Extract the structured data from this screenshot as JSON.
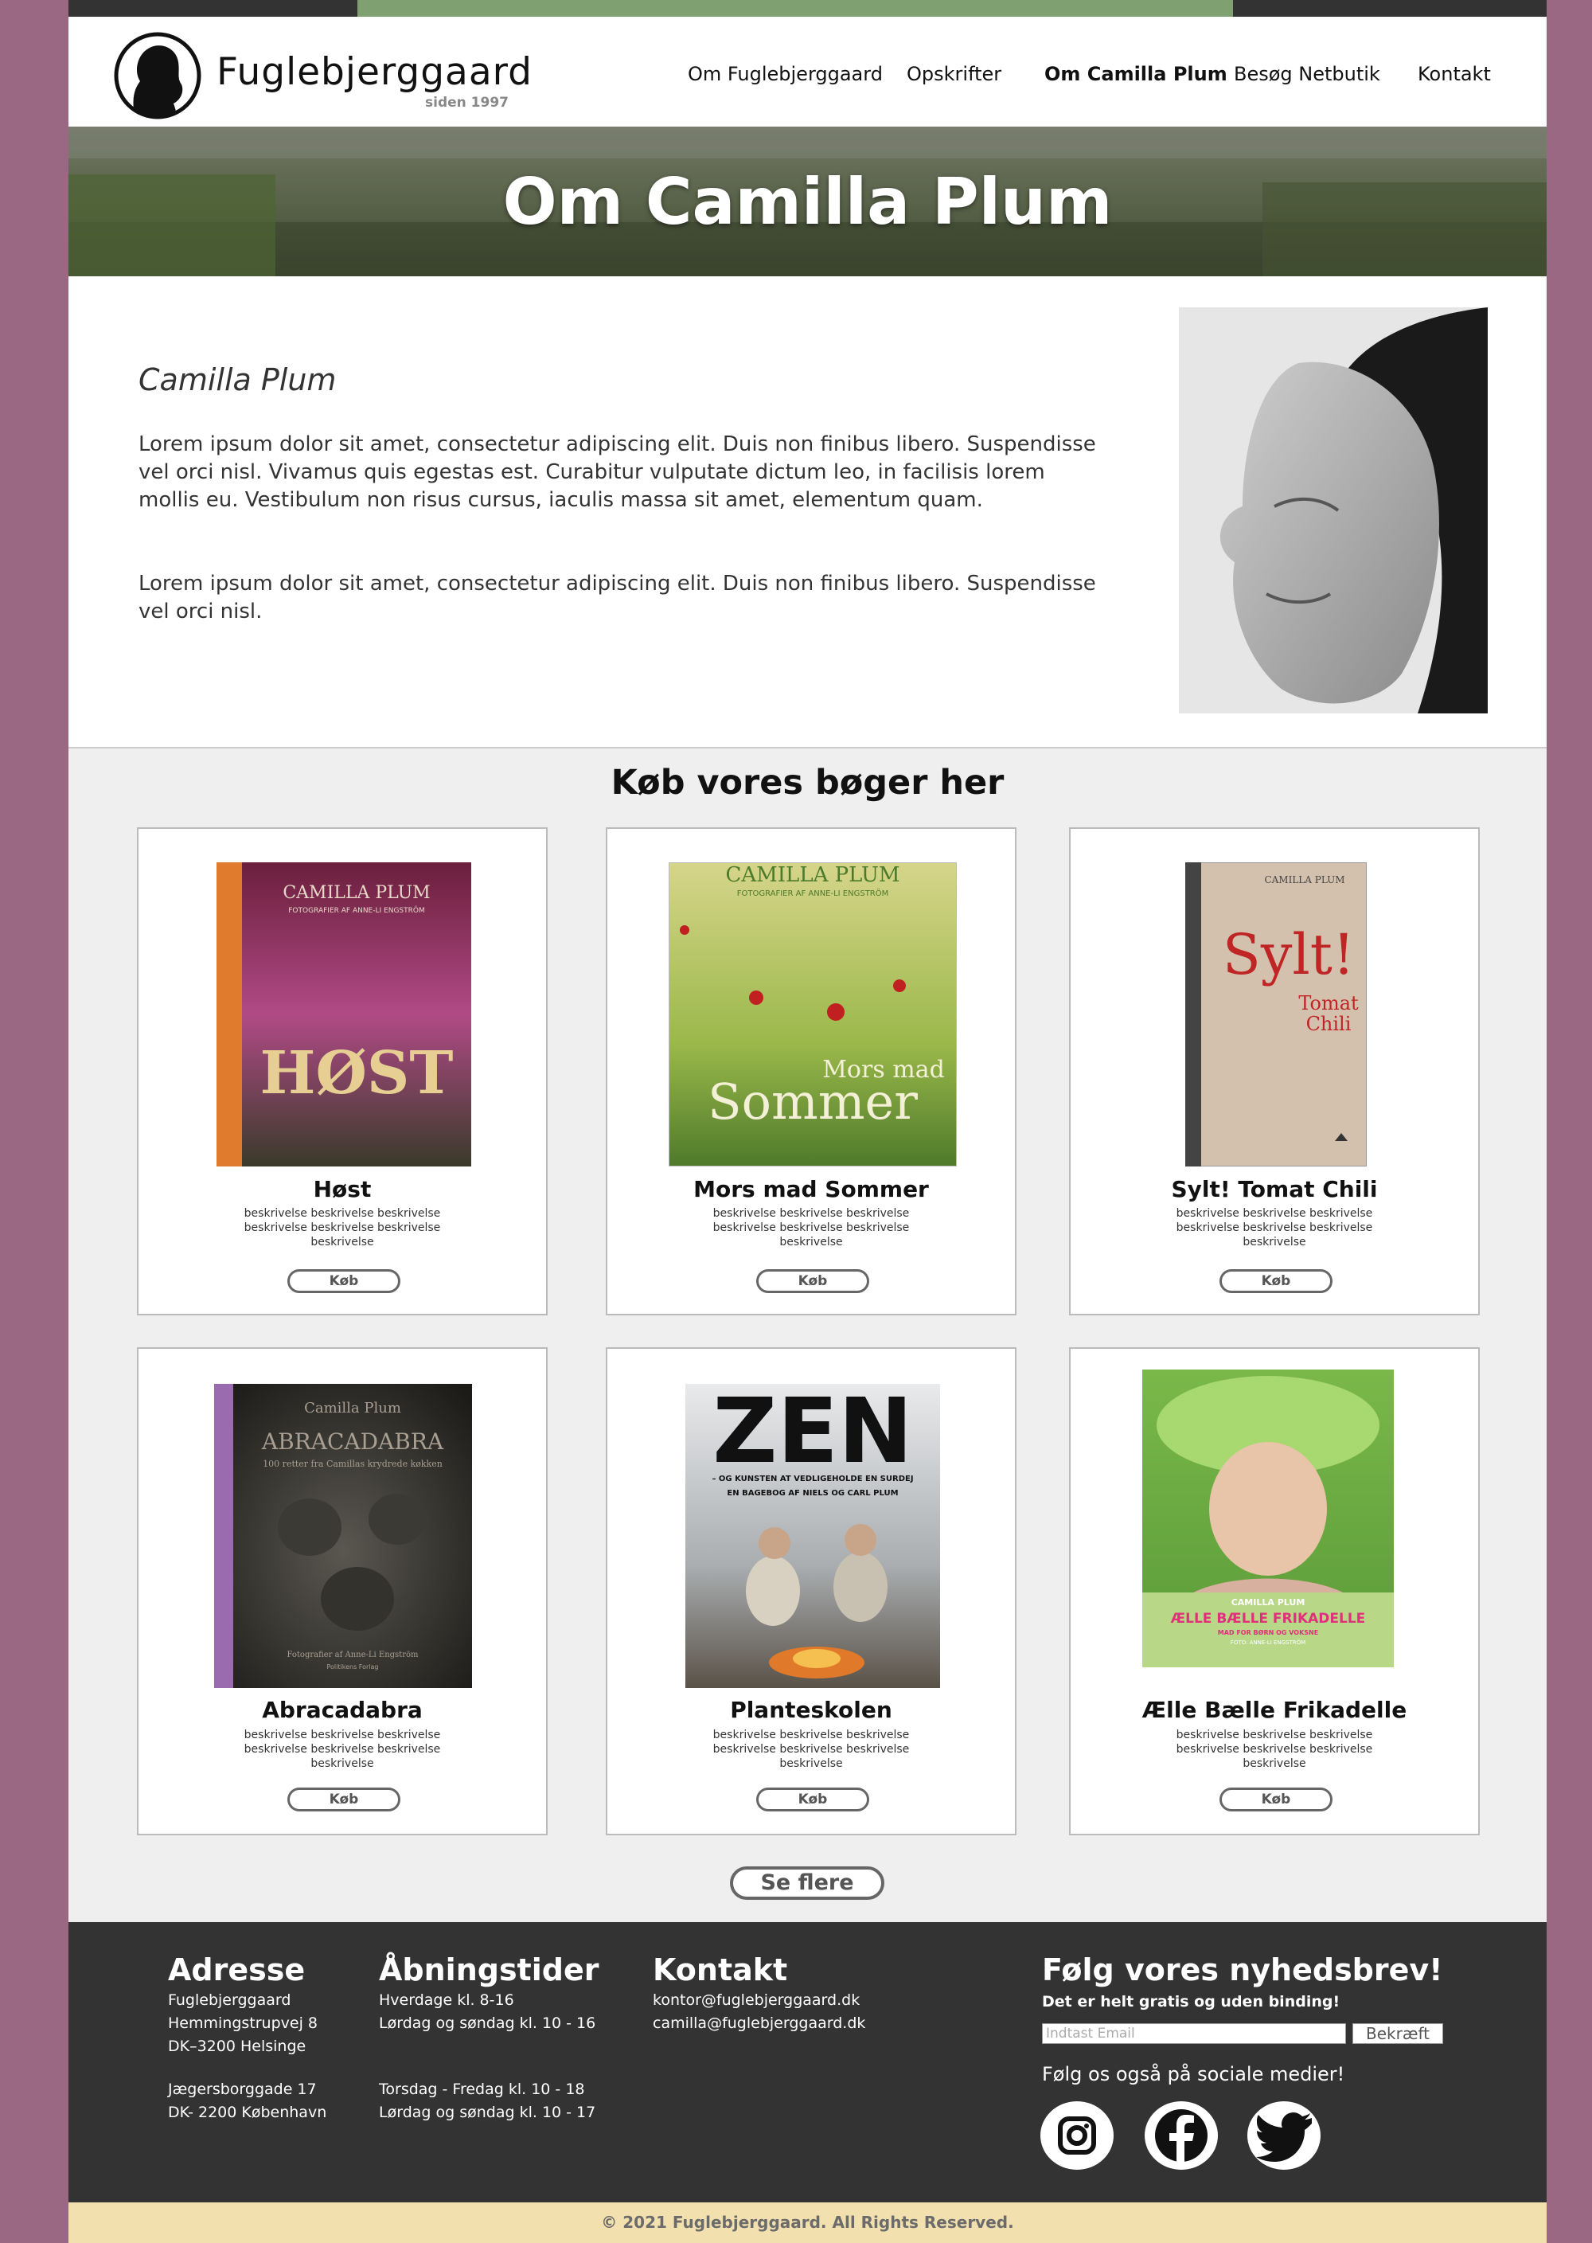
{
  "brand": {
    "name": "Fuglebjerggaard",
    "since": "siden 1997"
  },
  "nav": [
    {
      "label": "Om Fuglebjerggaard"
    },
    {
      "label": "Opskrifter"
    },
    {
      "label": "Om Camilla Plum",
      "active": true
    },
    {
      "label": "Besøg Netbutik"
    },
    {
      "label": "Kontakt"
    }
  ],
  "hero": {
    "title": "Om Camilla Plum"
  },
  "about": {
    "name": "Camilla Plum",
    "paragraphs": [
      "Lorem ipsum dolor sit amet, consectetur adipiscing elit. Duis non finibus libero. Suspendisse vel orci nisl. Vivamus quis egestas est. Curabitur vulputate dictum leo, in facilisis lorem mollis eu. Vestibulum non risus cursus, iaculis massa sit amet, elementum quam.",
      "Lorem ipsum dolor sit amet, consectetur adipiscing elit. Duis non finibus libero. Suspendisse vel orci nisl."
    ]
  },
  "shop": {
    "title": "Køb vores bøger her",
    "books": [
      {
        "title": "Høst",
        "description": "beskrivelse beskrivelse beskrivelse beskrivelse beskrivelse beskrivelse beskrivelse",
        "buy_label": "Køb",
        "cover": {
          "author": "CAMILLA PLUM",
          "photographer": "FOTOGRAFIER AF ANNE-LI ENGSTRÖM",
          "title": "HØST"
        }
      },
      {
        "title": "Mors mad Sommer",
        "description": "beskrivelse beskrivelse beskrivelse beskrivelse beskrivelse beskrivelse beskrivelse",
        "buy_label": "Køb",
        "cover": {
          "author": "CAMILLA PLUM",
          "photographer": "FOTOGRAFIER AF ANNE-LI ENGSTRÖM",
          "title_small": "Mors mad",
          "title": "Sommer"
        }
      },
      {
        "title": "Sylt! Tomat Chili",
        "description": "beskrivelse beskrivelse beskrivelse beskrivelse beskrivelse beskrivelse beskrivelse",
        "buy_label": "Køb",
        "cover": {
          "author": "CAMILLA PLUM",
          "title": "Sylt!",
          "subtitle_1": "Tomat",
          "subtitle_2": "Chili"
        }
      },
      {
        "title": "Abracadabra",
        "description": "beskrivelse beskrivelse beskrivelse beskrivelse beskrivelse beskrivelse beskrivelse",
        "buy_label": "Køb",
        "cover": {
          "author": "Camilla Plum",
          "title": "ABRACADABRA",
          "subtitle": "100 retter fra Camillas krydrede køkken",
          "photographer": "Fotografier af Anne-Li Engström",
          "publisher": "Politikens Forlag"
        }
      },
      {
        "title": "Planteskolen",
        "description": "beskrivelse beskrivelse beskrivelse beskrivelse beskrivelse beskrivelse beskrivelse",
        "buy_label": "Køb",
        "cover": {
          "title": "ZEN",
          "line_1": "– OG KUNSTEN AT VEDLIGEHOLDE EN SURDEJ",
          "line_2": "EN BAGEBOG AF NIELS OG CARL PLUM"
        }
      },
      {
        "title": "Ælle Bælle Frikadelle",
        "description": "beskrivelse beskrivelse beskrivelse beskrivelse beskrivelse beskrivelse beskrivelse",
        "buy_label": "Køb",
        "cover": {
          "author": "CAMILLA PLUM",
          "title": "ÆLLE BÆLLE FRIKADELLE",
          "subtitle": "MAD FOR BØRN OG VOKSNE",
          "photographer": "FOTO: ANNE-LI ENGSTRÖM"
        }
      }
    ],
    "more_label": "Se flere"
  },
  "footer": {
    "address": {
      "title": "Adresse",
      "lines": [
        "Fuglebjerggaard",
        "Hemmingstrupvej 8",
        "DK–3200 Helsinge",
        "",
        "Jægersborggade 17",
        "DK- 2200 København"
      ]
    },
    "hours": {
      "title": "Åbningstider",
      "lines": [
        "Hverdage kl. 8-16",
        "Lørdag og søndag kl. 10 - 16",
        "",
        "",
        "Torsdag - Fredag kl. 10 - 18",
        "Lørdag og søndag kl. 10 - 17"
      ]
    },
    "contact": {
      "title": "Kontakt",
      "lines": [
        "kontor@fuglebjerggaard.dk",
        "camilla@fuglebjerggaard.dk"
      ]
    },
    "newsletter": {
      "title": "Følg vores nyhedsbrev!",
      "subtitle": "Det er helt gratis og uden binding!",
      "placeholder": "Indtast Email",
      "button": "Bekræft",
      "social_text": "Følg os også på sociale medier!",
      "socials": [
        "instagram-icon",
        "facebook-icon",
        "twitter-icon"
      ]
    }
  },
  "copyright": "© 2021 Fuglebjerggaard. All Rights Reserved.",
  "colors": {
    "accent_green": "#7fa070",
    "frame_purple": "#9b6884",
    "dark": "#333333",
    "copyright_bg": "#f2e0ae"
  }
}
